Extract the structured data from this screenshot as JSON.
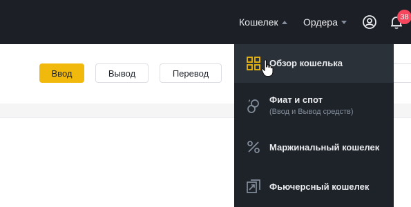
{
  "topbar": {
    "wallet_label": "Кошелек",
    "orders_label": "Ордера",
    "notification_count": "38"
  },
  "actions": {
    "deposit_label": "Ввод",
    "withdraw_label": "Вывод",
    "transfer_label": "Перевод"
  },
  "wallet_menu": {
    "items": [
      {
        "label": "Обзор кошелька",
        "icon": "grid-icon"
      },
      {
        "label": "Фиат и спот",
        "sublabel": "(Ввод и Вывод средств)",
        "icon": "fiat-spot-icon"
      },
      {
        "label": "Маржинальный кошелек",
        "icon": "percent-icon"
      },
      {
        "label": "Фьючерсный кошелек",
        "icon": "futures-icon"
      }
    ]
  },
  "colors": {
    "accent": "#f0b90b",
    "topbar_bg": "#1c1f26",
    "dropdown_bg": "#1e2329",
    "badge": "#f6465d"
  }
}
